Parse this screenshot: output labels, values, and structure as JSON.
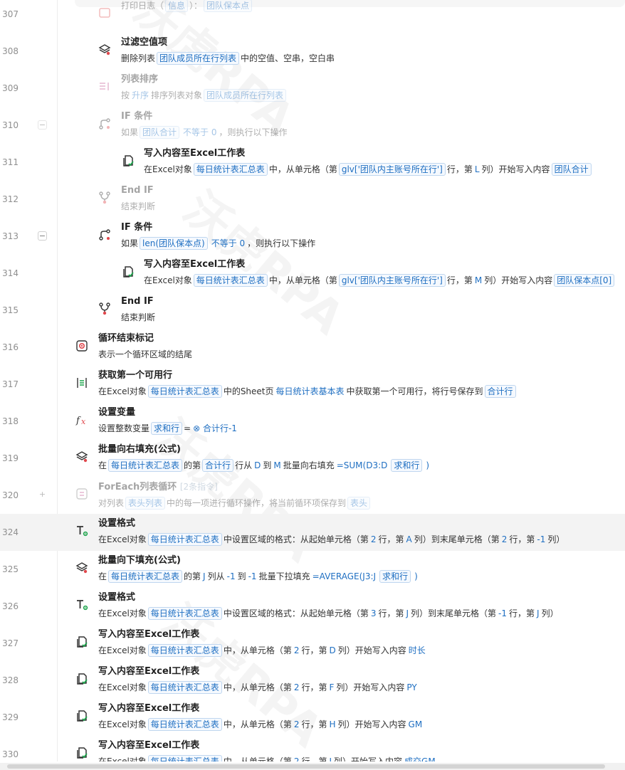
{
  "watermark": "沃虎RPA",
  "rows": [
    {
      "num": "307",
      "title": "",
      "desc": [
        [
          "t",
          "打印日志（"
        ],
        [
          "tag",
          "信息"
        ],
        [
          "t",
          "）："
        ],
        [
          "tag",
          "团队保本点"
        ]
      ],
      "icon": "log",
      "disabled": true
    },
    {
      "num": "308",
      "title": "过滤空值项",
      "desc": [
        [
          "t",
          "删除列表"
        ],
        [
          "tag",
          "团队成员所在行列表"
        ],
        [
          "t",
          "中的空值、空串，空白串"
        ]
      ],
      "icon": "layers"
    },
    {
      "num": "309",
      "title": "列表排序",
      "desc": [
        [
          "t",
          "按"
        ],
        [
          "v",
          "升序"
        ],
        [
          "t",
          "排序列表对象"
        ],
        [
          "tag",
          "团队成员所在行列表"
        ]
      ],
      "icon": "sort",
      "disabled": true
    },
    {
      "num": "310",
      "title": "IF 条件",
      "desc": [
        [
          "t",
          "如果"
        ],
        [
          "tag",
          "团队合计"
        ],
        [
          "v",
          "不等于 0"
        ],
        [
          "t",
          "，则执行以下操作"
        ]
      ],
      "icon": "if",
      "disabled": true,
      "fold": "−"
    },
    {
      "num": "311",
      "title": "写入内容至Excel工作表",
      "desc": [
        [
          "t",
          "在Excel对象"
        ],
        [
          "tag",
          "每日统计表汇总表"
        ],
        [
          "t",
          "中，从单元格（第"
        ],
        [
          "tag",
          "glv['团队内主账号所在行']"
        ],
        [
          "t",
          "行，第"
        ],
        [
          "v",
          "L"
        ],
        [
          "t",
          "列）开始写入内容"
        ],
        [
          "tag",
          "团队合计"
        ]
      ],
      "icon": "excel"
    },
    {
      "num": "312",
      "title": "End IF",
      "desc": [
        [
          "t",
          "结束判断"
        ]
      ],
      "icon": "endif",
      "disabled": true
    },
    {
      "num": "313",
      "title": "IF 条件",
      "desc": [
        [
          "t",
          "如果"
        ],
        [
          "tag",
          "len(团队保本点)"
        ],
        [
          "v",
          "不等于 0"
        ],
        [
          "t",
          "，则执行以下操作"
        ]
      ],
      "icon": "if",
      "fold": "−"
    },
    {
      "num": "314",
      "title": "写入内容至Excel工作表",
      "desc": [
        [
          "t",
          "在Excel对象"
        ],
        [
          "tag",
          "每日统计表汇总表"
        ],
        [
          "t",
          "中，从单元格（第"
        ],
        [
          "tag",
          "glv['团队内主账号所在行']"
        ],
        [
          "t",
          "行，第"
        ],
        [
          "v",
          "M"
        ],
        [
          "t",
          "列）开始写入内容"
        ],
        [
          "tag",
          "团队保本点[0]"
        ]
      ],
      "icon": "excel"
    },
    {
      "num": "315",
      "title": "End IF",
      "desc": [
        [
          "t",
          "结束判断"
        ]
      ],
      "icon": "endif"
    },
    {
      "num": "316",
      "title": "循环结束标记",
      "desc": [
        [
          "t",
          "表示一个循环区域的结尾"
        ]
      ],
      "icon": "loopend"
    },
    {
      "num": "317",
      "title": "获取第一个可用行",
      "desc": [
        [
          "t",
          "在Excel对象"
        ],
        [
          "tag",
          "每日统计表汇总表"
        ],
        [
          "t",
          "中的Sheet页"
        ],
        [
          "v",
          "每日统计表基本表"
        ],
        [
          "t",
          "中获取第一个可用行，将行号保存到"
        ],
        [
          "tag",
          "合计行"
        ]
      ],
      "icon": "rowget"
    },
    {
      "num": "318",
      "title": "设置变量",
      "desc": [
        [
          "t",
          "设置整数变量"
        ],
        [
          "tag",
          "求和行"
        ],
        [
          "t",
          "="
        ],
        [
          "v",
          "⊗ 合计行-1"
        ]
      ],
      "icon": "fx"
    },
    {
      "num": "319",
      "title": "批量向右填充(公式)",
      "desc": [
        [
          "t",
          "在"
        ],
        [
          "tag",
          "每日统计表汇总表"
        ],
        [
          "t",
          "的第"
        ],
        [
          "tag",
          "合计行"
        ],
        [
          "t",
          "行从"
        ],
        [
          "v",
          "D"
        ],
        [
          "t",
          "到"
        ],
        [
          "v",
          "M"
        ],
        [
          "t",
          "批量向右填充"
        ],
        [
          "v",
          "=SUM(D3:D"
        ],
        [
          "tag",
          "求和行"
        ],
        [
          "v",
          ")"
        ]
      ],
      "icon": "layers"
    },
    {
      "num": "320",
      "title": "ForEach列表循环",
      "count": "[2条指令]",
      "desc": [
        [
          "t",
          "对列表"
        ],
        [
          "tag",
          "表头列表"
        ],
        [
          "t",
          "中的每一项进行循环操作，将当前循环项保存到"
        ],
        [
          "tag",
          "表头"
        ]
      ],
      "icon": "foreach",
      "disabled": true,
      "fold": "+"
    },
    {
      "num": "324",
      "title": "设置格式",
      "desc": [
        [
          "t",
          "在Excel对象"
        ],
        [
          "tag",
          "每日统计表汇总表"
        ],
        [
          "t",
          "中设置区域的格式：从起始单元格（第"
        ],
        [
          "v",
          "2"
        ],
        [
          "t",
          "行，第"
        ],
        [
          "v",
          "A"
        ],
        [
          "t",
          "列）到末尾单元格（第"
        ],
        [
          "v",
          "2"
        ],
        [
          "t",
          "行，第"
        ],
        [
          "v",
          "-1"
        ],
        [
          "t",
          "列）"
        ]
      ],
      "icon": "format",
      "highlight": true
    },
    {
      "num": "325",
      "title": "批量向下填充(公式)",
      "desc": [
        [
          "t",
          "在"
        ],
        [
          "tag",
          "每日统计表汇总表"
        ],
        [
          "t",
          "的第"
        ],
        [
          "v",
          "J"
        ],
        [
          "t",
          "列从"
        ],
        [
          "v",
          "-1"
        ],
        [
          "t",
          "到"
        ],
        [
          "v",
          "-1"
        ],
        [
          "t",
          "批量下拉填充"
        ],
        [
          "v",
          "=AVERAGE(J3:J"
        ],
        [
          "tag",
          "求和行"
        ],
        [
          "v",
          ")"
        ]
      ],
      "icon": "layers"
    },
    {
      "num": "326",
      "title": "设置格式",
      "desc": [
        [
          "t",
          "在Excel对象"
        ],
        [
          "tag",
          "每日统计表汇总表"
        ],
        [
          "t",
          "中设置区域的格式：从起始单元格（第"
        ],
        [
          "v",
          "3"
        ],
        [
          "t",
          "行，第"
        ],
        [
          "v",
          "J"
        ],
        [
          "t",
          "列）到末尾单元格（第"
        ],
        [
          "v",
          "-1"
        ],
        [
          "t",
          "行，第"
        ],
        [
          "v",
          "J"
        ],
        [
          "t",
          "列）"
        ]
      ],
      "icon": "format"
    },
    {
      "num": "327",
      "title": "写入内容至Excel工作表",
      "desc": [
        [
          "t",
          "在Excel对象"
        ],
        [
          "tag",
          "每日统计表汇总表"
        ],
        [
          "t",
          "中，从单元格（第"
        ],
        [
          "v",
          "2"
        ],
        [
          "t",
          "行，第"
        ],
        [
          "v",
          "D"
        ],
        [
          "t",
          "列）开始写入内容"
        ],
        [
          "v",
          "时长"
        ]
      ],
      "icon": "excel"
    },
    {
      "num": "328",
      "title": "写入内容至Excel工作表",
      "desc": [
        [
          "t",
          "在Excel对象"
        ],
        [
          "tag",
          "每日统计表汇总表"
        ],
        [
          "t",
          "中，从单元格（第"
        ],
        [
          "v",
          "2"
        ],
        [
          "t",
          "行，第"
        ],
        [
          "v",
          "F"
        ],
        [
          "t",
          "列）开始写入内容"
        ],
        [
          "v",
          "PY"
        ]
      ],
      "icon": "excel"
    },
    {
      "num": "329",
      "title": "写入内容至Excel工作表",
      "desc": [
        [
          "t",
          "在Excel对象"
        ],
        [
          "tag",
          "每日统计表汇总表"
        ],
        [
          "t",
          "中，从单元格（第"
        ],
        [
          "v",
          "2"
        ],
        [
          "t",
          "行，第"
        ],
        [
          "v",
          "H"
        ],
        [
          "t",
          "列）开始写入内容"
        ],
        [
          "v",
          "GM"
        ]
      ],
      "icon": "excel"
    },
    {
      "num": "330",
      "title": "写入内容至Excel工作表",
      "desc": [
        [
          "t",
          "在Excel对象"
        ],
        [
          "tag",
          "每日统计表汇总表"
        ],
        [
          "t",
          "中，从单元格（第"
        ],
        [
          "v",
          "2"
        ],
        [
          "t",
          "行，第"
        ],
        [
          "v",
          "I"
        ],
        [
          "t",
          "列）开始写入内容"
        ],
        [
          "v",
          "成交GM"
        ]
      ],
      "icon": "excel"
    }
  ],
  "colors": {
    "accent": "#1f6fc2",
    "tag_border": "#bfd6ef",
    "highlight": "#f3f3f3"
  }
}
